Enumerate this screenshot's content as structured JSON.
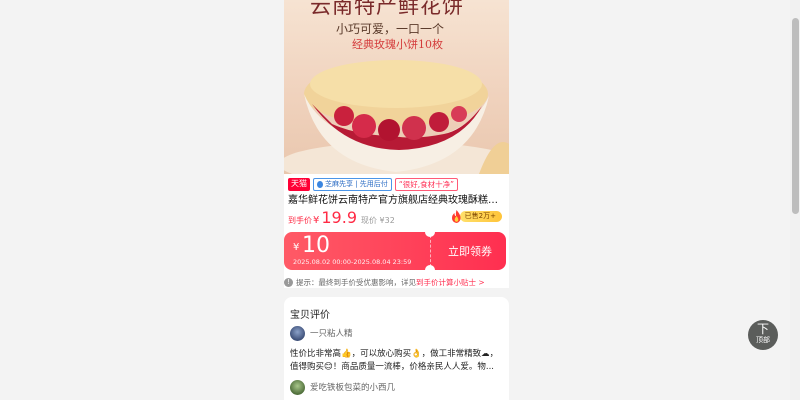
{
  "banner": {
    "headline": "云南特产鲜花饼",
    "subline": "小巧可爱，一口一个",
    "highlight": "经典玫瑰小饼10枚"
  },
  "product": {
    "tags": {
      "tmall": "天猫",
      "credit": "芝麻先享 | 先用后付",
      "quote": "“很好,食材十净”"
    },
    "title": "嘉华鲜花饼云南特产官方旗舰店经典玫瑰酥糕点心...",
    "price_label": "到手价",
    "currency": "¥",
    "price": "19.9",
    "original_price": "现价 ¥32",
    "sold": "已售2万+"
  },
  "coupon": {
    "currency": "¥",
    "value": "10",
    "period": "2025.08.02 00:00-2025.08.04 23:59",
    "claim_label": "立即领券"
  },
  "tip": {
    "icon": "info-icon",
    "text": "提示：最终到手价受优惠影响，详见",
    "link": "到手价计算小贴士 >"
  },
  "reviews": {
    "title": "宝贝评价",
    "items": [
      {
        "user": "一只粘人精",
        "text": "性价比非常高👍，可以放心购买👌，做工非常精致☁，值得购买😊！商品质量一流棒，价格亲民人人爱。物..."
      },
      {
        "user": "爱吃铁板包菜的小西几",
        "text": ""
      }
    ]
  },
  "back_to_top": {
    "arrow": "下",
    "label": "顶部"
  },
  "colors": {
    "accent": "#ff2f50",
    "tmall": "#ff0036",
    "sold_pill": "#ffc43a"
  }
}
